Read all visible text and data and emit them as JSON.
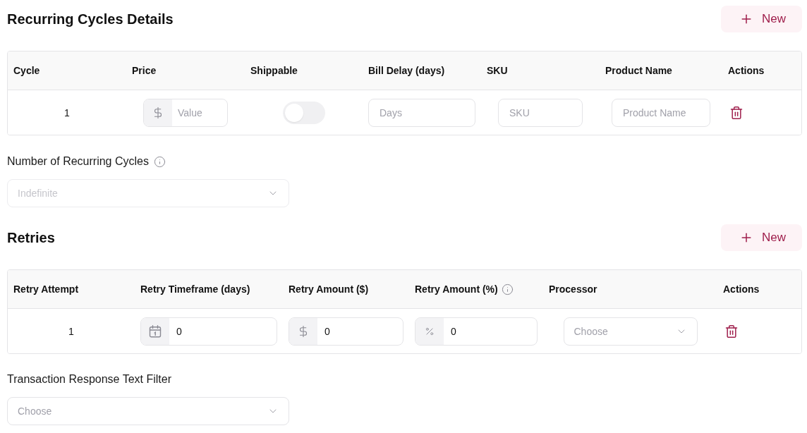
{
  "recurring_cycles": {
    "title": "Recurring Cycles Details",
    "new_button": "New",
    "table": {
      "columns": [
        {
          "label": "Cycle",
          "info": false
        },
        {
          "label": "Price",
          "info": false
        },
        {
          "label": "Shippable",
          "info": false
        },
        {
          "label": "Bill Delay (days)",
          "info": false
        },
        {
          "label": "SKU",
          "info": false
        },
        {
          "label": "Product Name",
          "info": false
        },
        {
          "label": "Actions",
          "info": false
        }
      ],
      "rows": [
        {
          "cells": [
            {
              "kind": "number",
              "text": "1"
            },
            {
              "kind": "currency_input",
              "placeholder": "Value"
            },
            {
              "kind": "toggle",
              "on": false
            },
            {
              "kind": "input",
              "placeholder": "Days"
            },
            {
              "kind": "input",
              "placeholder": "SKU"
            },
            {
              "kind": "input",
              "placeholder": "Product Name"
            },
            {
              "kind": "delete"
            }
          ]
        }
      ]
    },
    "cycles_count": {
      "label": "Number of Recurring Cycles",
      "info": true,
      "placeholder": "Indefinite",
      "disabled": true
    }
  },
  "retries": {
    "title": "Retries",
    "new_button": "New",
    "table": {
      "columns": [
        {
          "label": "Retry Attempt",
          "info": false
        },
        {
          "label": "Retry Timeframe (days)",
          "info": false
        },
        {
          "label": "Retry Amount ($)",
          "info": false
        },
        {
          "label": "Retry Amount (%)",
          "info": true
        },
        {
          "label": "Processor",
          "info": false
        },
        {
          "label": "Actions",
          "info": false
        }
      ],
      "rows": [
        {
          "cells": [
            {
              "kind": "number",
              "text": "1"
            },
            {
              "kind": "date_input",
              "value": "0"
            },
            {
              "kind": "currency_input",
              "value": "0"
            },
            {
              "kind": "percent_input",
              "value": "0"
            },
            {
              "kind": "select",
              "placeholder": "Choose",
              "disabled": false
            },
            {
              "kind": "delete"
            }
          ]
        }
      ]
    }
  },
  "response_filter": {
    "label": "Transaction Response Text Filter",
    "info": false,
    "placeholder": "Choose",
    "disabled": false
  }
}
